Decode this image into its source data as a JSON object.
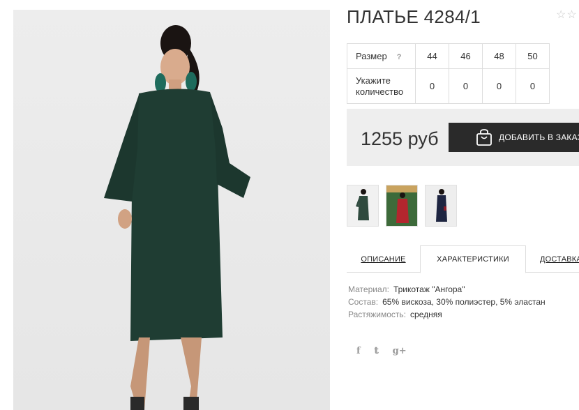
{
  "product": {
    "title": "ПЛАТЬЕ 4284/1",
    "rating_stars": 2
  },
  "size_table": {
    "size_label": "Размер",
    "help_icon": "?",
    "sizes": [
      "44",
      "46",
      "48",
      "50"
    ],
    "qty_label": "Укажите количество",
    "quantities": [
      "0",
      "0",
      "0",
      "0"
    ]
  },
  "purchase": {
    "price": "1255 руб",
    "add_button_label": "ДОБАВИТЬ В ЗАКАЗ",
    "button_icon": "shopping-bag-icon"
  },
  "gallery": {
    "thumbnails": [
      {
        "name": "green dress thumbnail",
        "color": "#2f4a3e"
      },
      {
        "name": "red dress thumbnail",
        "color": "#b3262e"
      },
      {
        "name": "navy dress thumbnail",
        "color": "#1e2541"
      }
    ]
  },
  "tabs": [
    {
      "label": "ОПИСАНИЕ",
      "active": false
    },
    {
      "label": "ХАРАКТЕРИСТИКИ",
      "active": true
    },
    {
      "label": "ДОСТАВКА",
      "active": false
    }
  ],
  "specs": [
    {
      "key": "Материал:",
      "value": "Трикотаж \"Ангора\""
    },
    {
      "key": "Состав:",
      "value": "65% вискоза, 30% полиэстер, 5% эластан"
    },
    {
      "key": "Растяжимость:",
      "value": "средняя"
    }
  ],
  "social": [
    {
      "glyph": "f",
      "icon": "facebook-icon"
    },
    {
      "glyph": "𝕥",
      "icon": "twitter-icon"
    },
    {
      "glyph": "g+",
      "icon": "google-plus-icon"
    }
  ],
  "colors": {
    "dress_green": "#1f3d33",
    "button_dark": "#2a2a2a",
    "panel_gray": "#eeeeee"
  }
}
